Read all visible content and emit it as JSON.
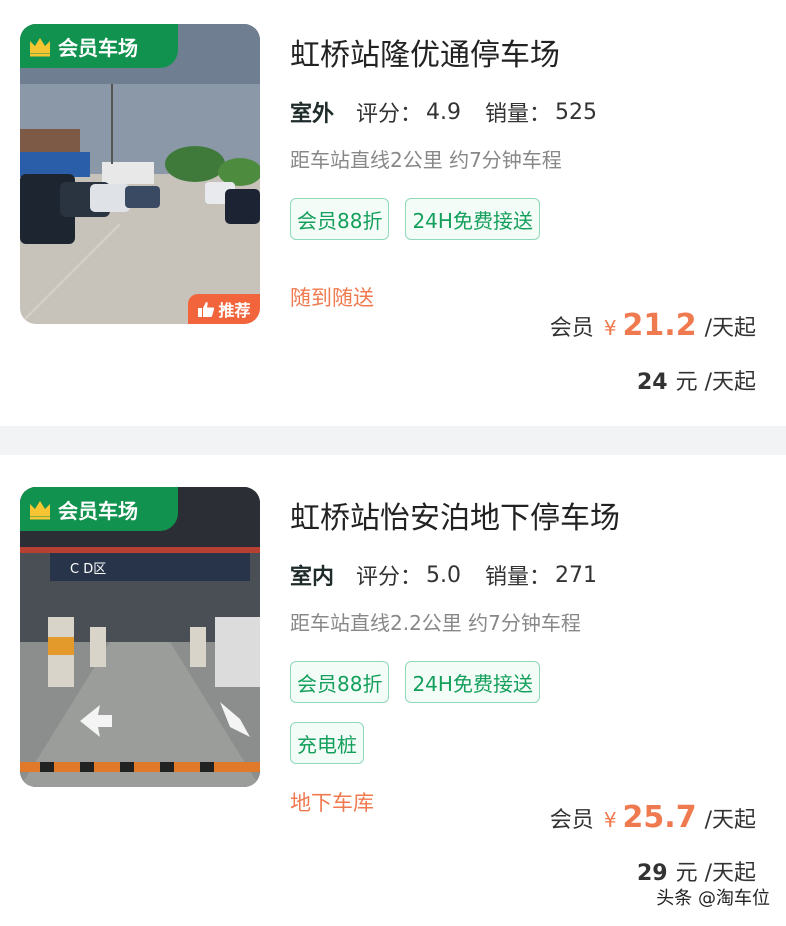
{
  "listings": [
    {
      "member_tag": "会员车场",
      "recommend_tag": "推荐",
      "title": "虹桥站隆优通停车场",
      "environment": "室外",
      "rating_label": "评分：",
      "rating": "4.9",
      "sales_label": "销量：",
      "sales": "525",
      "distance": "距车站直线2公里 约7分钟车程",
      "tags": [
        "会员88折",
        "24H免费接送"
      ],
      "feature": "随到随送",
      "member_price_label": "会员",
      "currency": "¥",
      "member_price": "21.2",
      "price_unit": "/天起",
      "original_price": "24",
      "original_unit": "元 /天起"
    },
    {
      "member_tag": "会员车场",
      "title": "虹桥站怡安泊地下停车场",
      "environment": "室内",
      "rating_label": "评分：",
      "rating": "5.0",
      "sales_label": "销量：",
      "sales": "271",
      "distance": "距车站直线2.2公里 约7分钟车程",
      "tags": [
        "会员88折",
        "24H免费接送"
      ],
      "tags_row2": [
        "充电桩"
      ],
      "feature": "地下车库",
      "member_price_label": "会员",
      "currency": "¥",
      "member_price": "25.7",
      "price_unit": "/天起",
      "original_price": "29",
      "original_unit": "元 /天起",
      "photo_sign": "C D区"
    }
  ],
  "watermark": "头条 @淘车位",
  "colors": {
    "member_green": "#11924f",
    "accent_orange": "#f07a4f",
    "tag_green": "#14a05c"
  },
  "icons": {
    "member_tag": "crown-icon",
    "recommend": "thumbs-up-icon"
  }
}
